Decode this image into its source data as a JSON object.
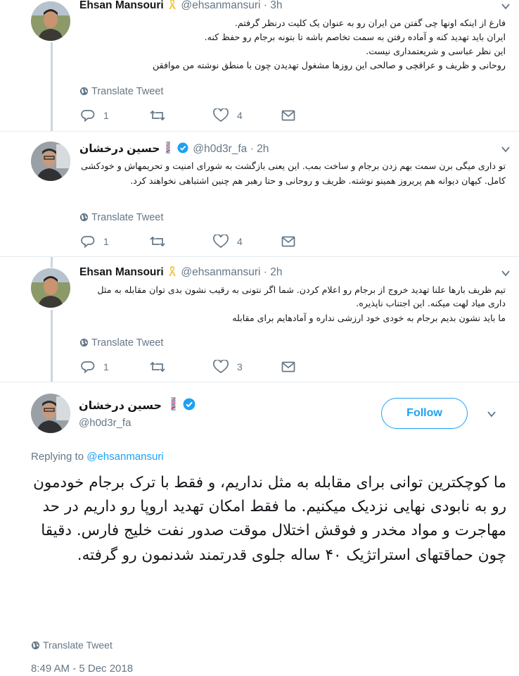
{
  "tweets": [
    {
      "name": "Ehsan Mansouri",
      "handle": "@ehsanmansuri",
      "time": "3h",
      "paragraphs": [
        "فارغ از اینکه اونها چی گفتن من ایران رو به عنوان یک کلیت درنظر گرفتم.",
        "ایران باید تهدید کنه و آماده رفتن به سمت تخاصم باشه تا بتونه برجام رو حفظ کنه.",
        "این نظر عباسی و شریعتمداری نیست.",
        "روحانی و ظریف و عراقچی و صالحی این روزها مشغول تهدیدن چون با منطق نوشته من موافقن"
      ],
      "translate_label": "Translate Tweet",
      "replies": "1",
      "retweets": "",
      "likes": "4"
    },
    {
      "name": "حسین درخشان",
      "handle": "@h0d3r_fa",
      "time": "2h",
      "paragraphs": [
        "تو داری میگی برن سمت بهم زدن برجام و ساخت بمب. این یعنی بازگشت به شورای امنیت و تحریمهاش و خودکشی کامل. کیهان دیوانه هم پریروز همینو نوشته. ظریف و روحانی و حتا رهبر هم چنین اشتباهی نخواهند کرد."
      ],
      "translate_label": "Translate Tweet",
      "replies": "1",
      "retweets": "",
      "likes": "4"
    },
    {
      "name": "Ehsan Mansouri",
      "handle": "@ehsanmansuri",
      "time": "2h",
      "paragraphs": [
        "تیم ظریف بارها علنا تهدید خروج از برجام رو اعلام کردن. شما اگر نتونی به رقیب نشون بدی توان مقابله به مثل داری میاد لهت میکنه. این اجتناب ناپذیره.",
        "ما باید نشون بدیم برجام به خودی خود ارزشی نداره و آمادهایم برای مقابله"
      ],
      "translate_label": "Translate Tweet",
      "replies": "1",
      "retweets": "",
      "likes": "3"
    }
  ],
  "main_tweet": {
    "name": "حسین درخشان",
    "handle": "@h0d3r_fa",
    "follow_label": "Follow",
    "replying_prefix": "Replying to",
    "replying_to": "@ehsanmansuri",
    "text": "ما کوچکترین توانی برای مقابله به مثل نداریم، و فقط با ترک برجام خودمون رو به نابودی نهایی نزدیک میکنیم. ما فقط امکان تهدید اروپا رو داریم در حد مهاجرت و مواد مخدر و فوقش اختلال موقت صدور نفت خلیج فارس. دقیقا چون حماقتهای استراتژیک ۴۰ ساله جلوی قدرتمند شدنمون رو گرفته.",
    "translate_label": "Translate Tweet",
    "timestamp": "8:49 AM - 5 Dec 2018"
  },
  "separators": {
    "dot": "·"
  },
  "colors": {
    "accent": "#1da1f2",
    "muted": "#657786",
    "text": "#14171a",
    "verified": "#1da1f2",
    "ribbon": "#f5c542"
  },
  "icons": [
    "yellow-ribbon-icon",
    "verified-icon",
    "barber-pole-icon",
    "globe-icon",
    "reply-icon",
    "retweet-icon",
    "like-icon",
    "message-icon",
    "chevron-down-icon"
  ]
}
